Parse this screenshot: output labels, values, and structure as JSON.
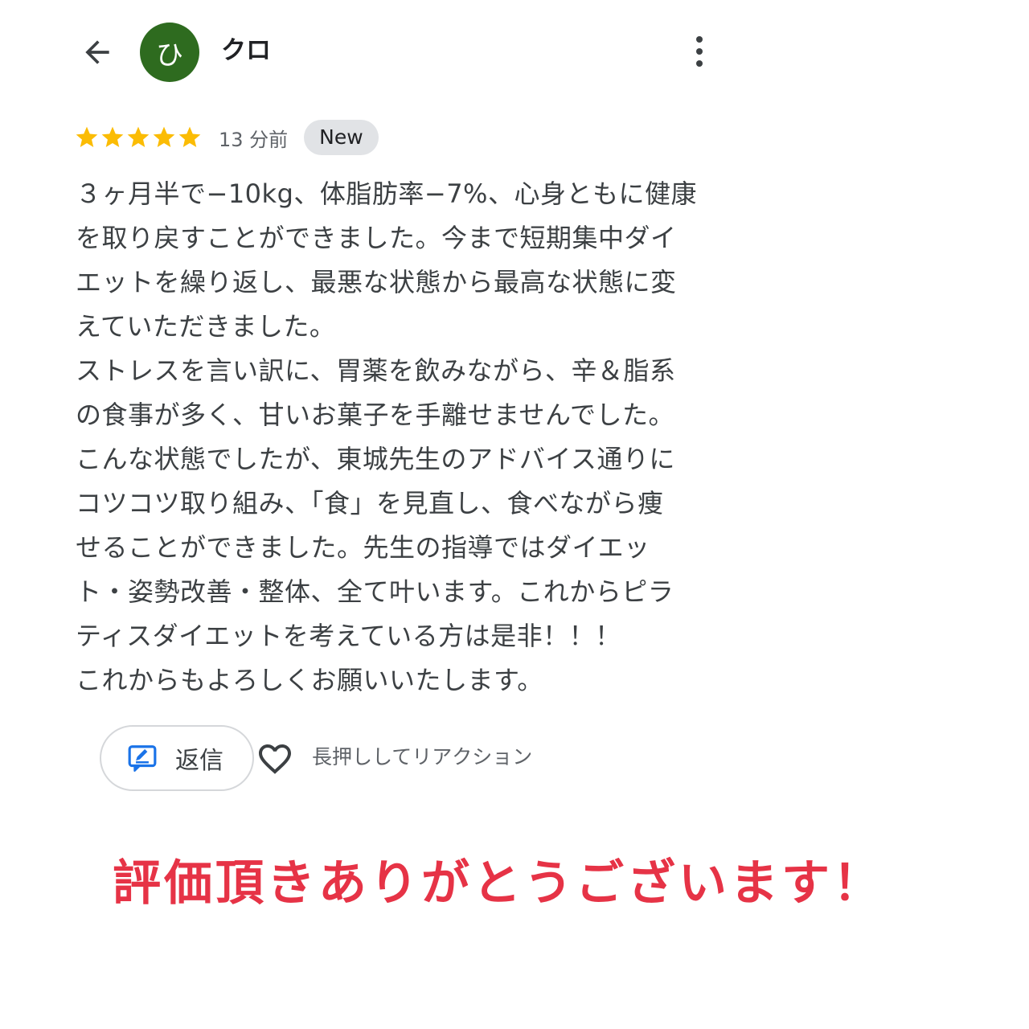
{
  "header": {
    "avatar_initial": "ひ",
    "user_name": "クロ",
    "avatar_color": "#2e6b1f"
  },
  "review": {
    "rating": 5,
    "time_ago": "13 分前",
    "badge": "New",
    "star_color": "#fbbc04",
    "lines": [
      "３ヶ月半で−10kg、体脂肪率−7%、心身ともに健康",
      "を取り戻すことができました。今まで短期集中ダイ",
      "エットを繰り返し、最悪な状態から最高な状態に変",
      "えていただきました。",
      "ストレスを言い訳に、胃薬を飲みながら、辛＆脂系",
      "の食事が多く、甘いお菓子を手離せませんでした。",
      "こんな状態でしたが、東城先生のアドバイス通りに",
      "コツコツ取り組み、「食」を見直し、食べながら痩",
      "せることができました。先生の指導ではダイエッ",
      "ト・姿勢改善・整体、全て叶います。これからピラ",
      "ティスダイエットを考えている方は是非！！！",
      "これからもよろしくお願いいたします。"
    ]
  },
  "actions": {
    "reply_label": "返信",
    "reaction_hint": "長押ししてリアクション",
    "accent_color": "#1a73e8"
  },
  "overlay": {
    "thanks_text": "評価頂きありがとうございます！",
    "color": "#e63346"
  }
}
